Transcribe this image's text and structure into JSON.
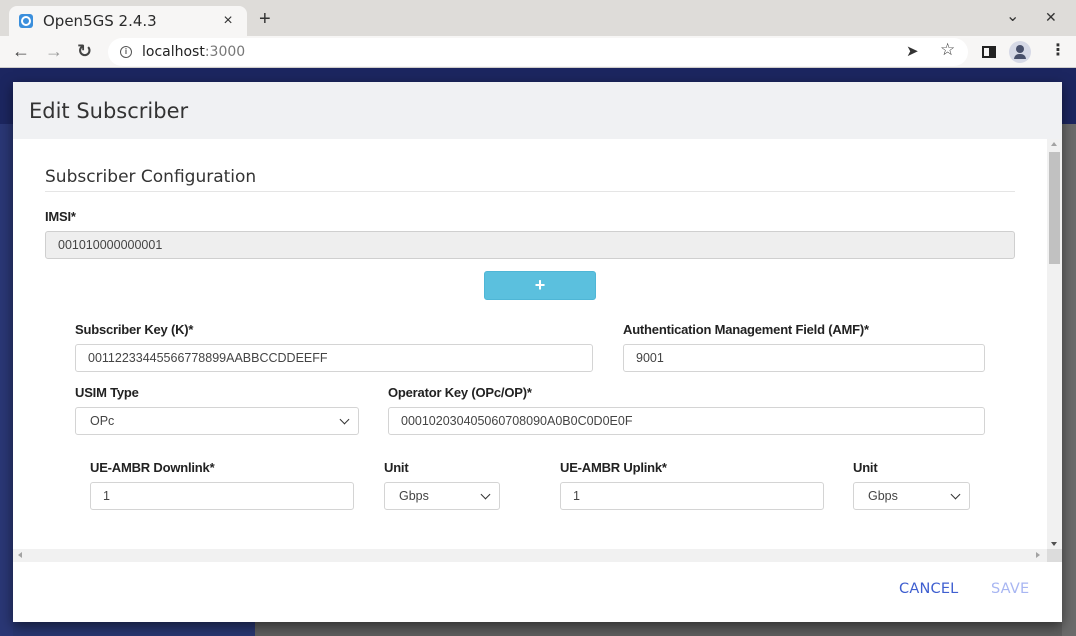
{
  "browser": {
    "tab_title": "Open5GS 2.4.3",
    "tab_close": "×",
    "new_tab": "+",
    "url_host": "localhost",
    "url_port": ":3000",
    "icons": {
      "back": "←",
      "forward": "→",
      "reload": "↻",
      "info": "i",
      "send": "➤",
      "star": "☆",
      "menu": "⋮",
      "chevron_down": "⌄",
      "close_window": "✕"
    }
  },
  "modal": {
    "title": "Edit Subscriber",
    "section_title": "Subscriber Configuration",
    "add_button_label": "+",
    "fields": {
      "imsi": {
        "label": "IMSI*",
        "value": "001010000000001"
      },
      "subscriber_key": {
        "label": "Subscriber Key (K)*",
        "value": "00112233445566778899AABBCCDDEEFF"
      },
      "amf": {
        "label": "Authentication Management Field (AMF)*",
        "value": "9001"
      },
      "usim_type": {
        "label": "USIM Type",
        "value": "OPc"
      },
      "operator_key": {
        "label": "Operator Key (OPc/OP)*",
        "value": "000102030405060708090A0B0C0D0E0F"
      },
      "ue_ambr_downlink": {
        "label": "UE-AMBR Downlink*",
        "value": "1"
      },
      "downlink_unit": {
        "label": "Unit",
        "value": "Gbps"
      },
      "ue_ambr_uplink": {
        "label": "UE-AMBR Uplink*",
        "value": "1"
      },
      "uplink_unit": {
        "label": "Unit",
        "value": "Gbps"
      }
    },
    "footer": {
      "cancel_label": "CANCEL",
      "save_label": "SAVE"
    }
  },
  "colors": {
    "accent": "#3f5fd0",
    "accent_disabled": "#a8b6f2",
    "add_button": "#5bc0de",
    "app_bar": "#1c2660"
  }
}
